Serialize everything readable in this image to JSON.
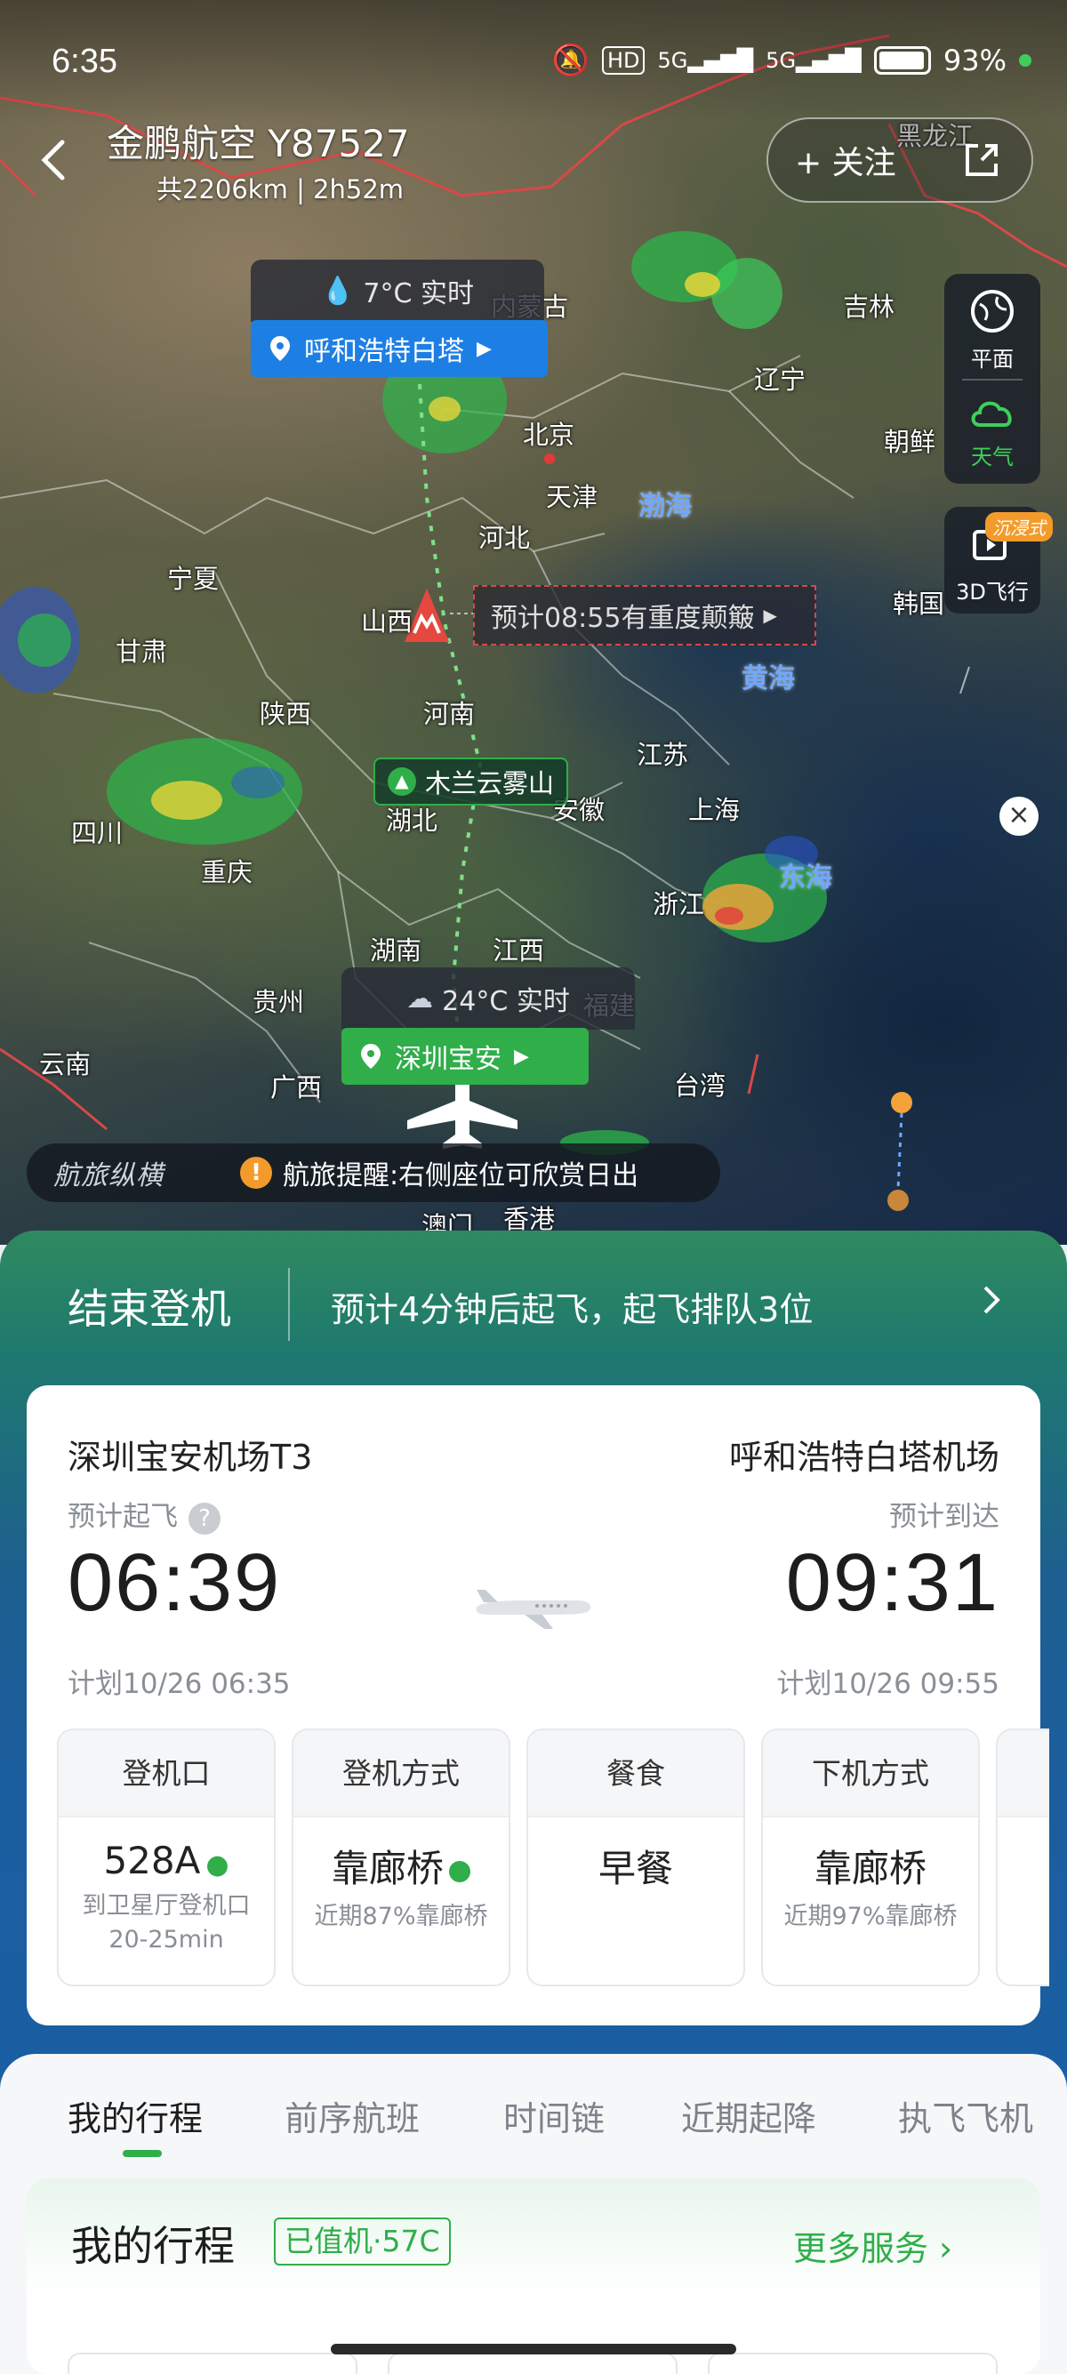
{
  "status_bar": {
    "time": "6:35",
    "battery": "93%"
  },
  "header": {
    "airline_flight": "金鹏航空 Y87527",
    "route_summary": "共2206km | 2h52m",
    "follow_label": "+ 关注"
  },
  "map_tools": {
    "flat_label": "平面",
    "weather_label": "天气",
    "flight3d_label": "3D飞行",
    "immersive_badge": "沉浸式"
  },
  "destination_weather": {
    "temp": "7°C 实时",
    "airport": "呼和浩特白塔"
  },
  "origin_weather": {
    "temp": "24°C 实时",
    "airport": "深圳宝安"
  },
  "turbulence_tag": "预计08:55有重度颠簸",
  "landmark_tag": "木兰云雾山",
  "map_labels": {
    "heilongjiang": "黑龙江",
    "neimenggu": "内蒙古",
    "jilin": "吉林",
    "liaoning": "辽宁",
    "beijing": "北京",
    "tianjin": "天津",
    "hebei": "河北",
    "chaoxian": "朝鲜",
    "hanguo": "韩国",
    "ningxia": "宁夏",
    "gansu": "甘肃",
    "shanxi": "山西",
    "shaanxi": "陕西",
    "henan": "河南",
    "jiangsu": "江苏",
    "shanghai": "上海",
    "anhui": "安徽",
    "hubei": "湖北",
    "sichuan": "四川",
    "chongqing": "重庆",
    "zhejiang": "浙江",
    "hunan": "湖南",
    "jiangxi": "江西",
    "guizhou": "贵州",
    "fujian": "福建",
    "yunnan": "云南",
    "guangxi": "广西",
    "taiwan": "台湾",
    "aomen": "澳门",
    "xianggang": "香港"
  },
  "sea_labels": {
    "bohai": "渤海",
    "huanghai": "黄海",
    "donghai": "东海"
  },
  "notice": {
    "logo": "航旅纵横",
    "text": "航旅提醒:右侧座位可欣赏日出"
  },
  "flight_status": {
    "title": "结束登机",
    "description": "预计4分钟后起飞，起飞排队3位"
  },
  "departure": {
    "airport": "深圳宝安机场T3",
    "label": "预计起飞",
    "time": "06:39",
    "scheduled": "计划10/26 06:35"
  },
  "arrival": {
    "airport": "呼和浩特白塔机场",
    "label": "预计到达",
    "time": "09:31",
    "scheduled": "计划10/26 09:55"
  },
  "info_boxes": [
    {
      "title": "登机口",
      "value": "528A",
      "sub1": "到卫星厅登机口",
      "sub2": "20-25min"
    },
    {
      "title": "登机方式",
      "value": "靠廊桥",
      "sub1": "近期87%靠廊桥",
      "sub2": ""
    },
    {
      "title": "餐食",
      "value": "早餐",
      "sub1": "",
      "sub2": ""
    },
    {
      "title": "下机方式",
      "value": "靠廊桥",
      "sub1": "近期97%靠廊桥",
      "sub2": ""
    }
  ],
  "tabs": [
    "我的行程",
    "前序航班",
    "时间链",
    "近期起降",
    "执飞飞机"
  ],
  "my_trip": {
    "title": "我的行程",
    "badge": "已值机·57C",
    "more_label": "更多服务"
  },
  "colors": {
    "accent_green": "#2fae4a",
    "airport_blue": "#1d7fe4",
    "warning_orange": "#f39b2a"
  }
}
